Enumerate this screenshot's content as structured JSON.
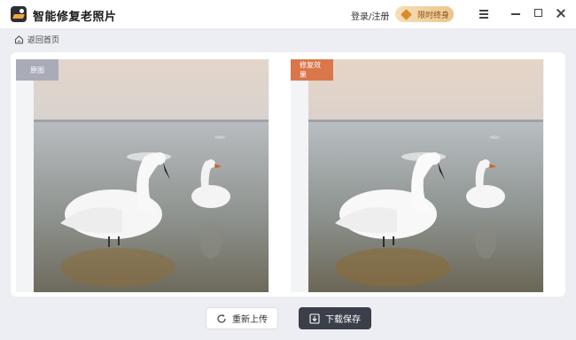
{
  "app": {
    "title": "智能修复老照片",
    "login_label": "登录/注册",
    "vip_label": "限时终身"
  },
  "nav": {
    "back_label": "返回首页"
  },
  "compare": {
    "original_label": "原图",
    "repaired_label": "修复效果"
  },
  "actions": {
    "reupload_label": "重新上传",
    "download_label": "下载保存"
  },
  "icons": {
    "logo": "photo-logo-icon",
    "vip": "diamond-icon",
    "menu": "hamburger-menu-icon",
    "minimize": "minimize-icon",
    "maximize": "maximize-icon",
    "close": "close-icon",
    "home": "home-icon",
    "reupload": "refresh-icon",
    "download": "download-icon"
  },
  "colors": {
    "accent_orange": "#d9774a",
    "vip_gold": "#ecc48c",
    "dark_button": "#3b3f4a",
    "original_tag": "#a9acb7"
  }
}
